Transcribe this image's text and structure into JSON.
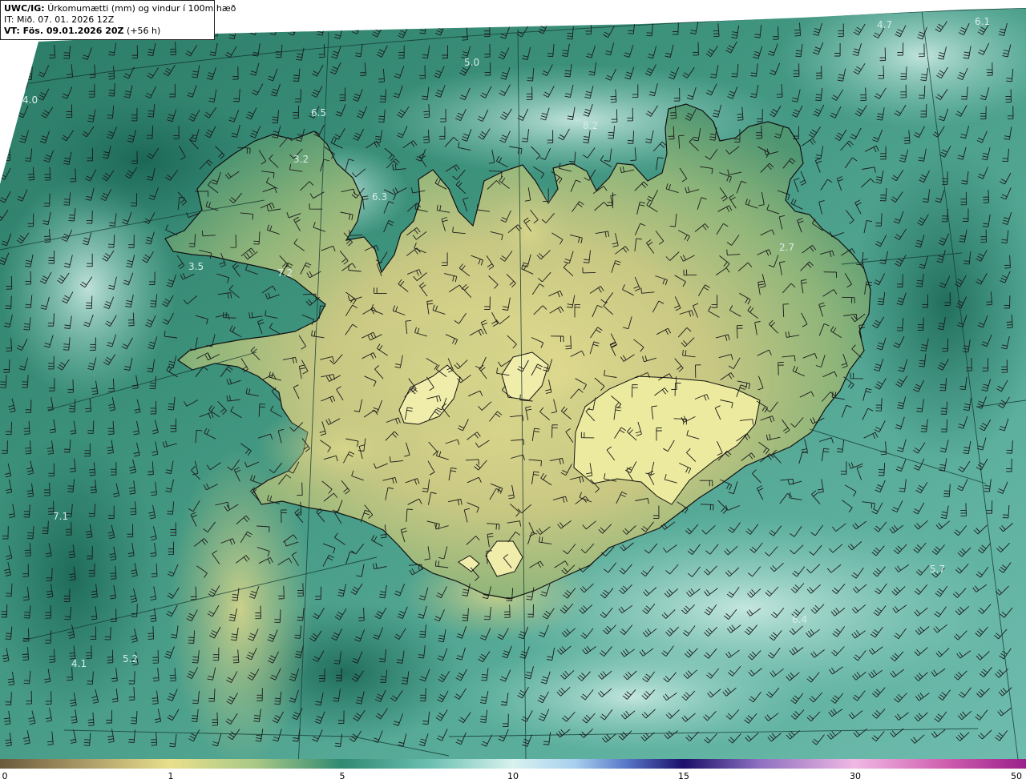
{
  "header": {
    "product": "UWC/IG:",
    "field": "Úrkomumætti (mm) og vindur í 100m hæð",
    "it_line": "IT: Mið. 07. 01. 2026 12Z",
    "vt_prefix": "VT: Fös. 09.01.2026 20Z",
    "vt_suffix": "(+56 h)"
  },
  "colorbar": {
    "ticks": [
      "0",
      "1",
      "5",
      "10",
      "15",
      "30",
      "50"
    ],
    "colors": [
      "#6b5a3c",
      "#a99866",
      "#e8e08c",
      "#7ec08c",
      "#2f8a72",
      "#7fd0c8",
      "#d8f2ee",
      "#7aa8e0",
      "#3a3aa8",
      "#1a0f6a",
      "#c8a0d8",
      "#f0b0e0",
      "#d060b0",
      "#9a208a"
    ]
  },
  "values": [
    "4.7",
    "6.1",
    "5.0",
    "4.0",
    "6.5",
    "8.2",
    "3.2",
    "6.3",
    "2.7",
    "3.5",
    "7.2",
    "7.1",
    "5.7",
    "6.4",
    "4.1",
    "5.2"
  ],
  "colors": {
    "sea_dark": "#1f6e5e",
    "sea_mid": "#3f9680",
    "sea_light": "#8fd0c4",
    "land_low": "#3d8a6a",
    "land_mid": "#9cb876",
    "land_high": "#e4de92",
    "coast": "#111111"
  }
}
